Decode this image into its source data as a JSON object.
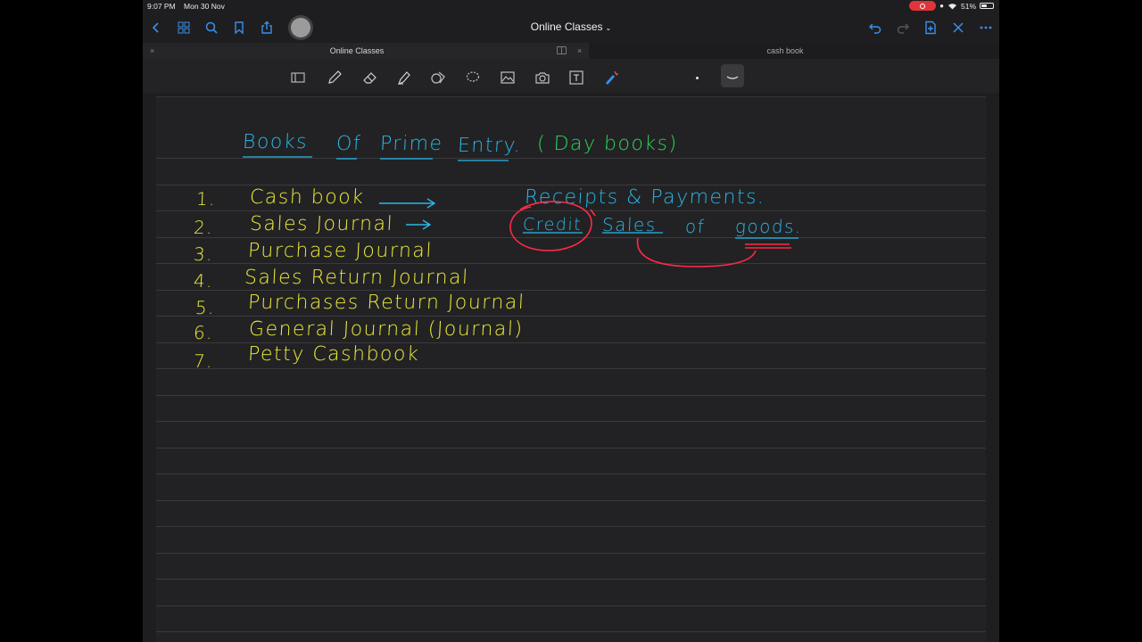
{
  "status": {
    "time": "9:07 PM",
    "date": "Mon 30 Nov",
    "battery": "51%",
    "battery_level": 0.51
  },
  "nav": {
    "title": "Online Classes"
  },
  "tabs": [
    {
      "label": "Online Classes",
      "active": true
    },
    {
      "label": "cash book",
      "active": false
    }
  ],
  "toolbar": {
    "tools": [
      "shapes-icon",
      "pen-icon",
      "eraser-icon",
      "highlighter-icon",
      "lasso-shapes-icon",
      "lasso-icon",
      "image-icon",
      "camera-icon",
      "text-icon",
      "laser-pointer-icon"
    ]
  },
  "note": {
    "heading": {
      "books": "Books",
      "of": "Of",
      "prime": "Prime",
      "entry": "Entry.",
      "day_books": "( Day books)"
    },
    "items": [
      {
        "number": "1.",
        "label": "Cash book"
      },
      {
        "number": "2.",
        "label": "Sales Journal"
      },
      {
        "number": "3.",
        "label": "Purchase Journal"
      },
      {
        "number": "4.",
        "label": "Sales Return Journal"
      },
      {
        "number": "5.",
        "label": "Purchases Return Journal"
      },
      {
        "number": "6.",
        "label": "General Journal (Journal)"
      },
      {
        "number": "7.",
        "label": "Petty Cashbook"
      }
    ],
    "notes": {
      "receipts": "Receipts & Payments.",
      "credit": "Credit",
      "sales": "Sales",
      "of": "of",
      "goods": "goods."
    }
  },
  "colors": {
    "heading": "#28b8e8",
    "list": "#ecec3a",
    "annotation": "#28d957",
    "ink_red": "#ff2a45",
    "background": "#222224",
    "nav_blue": "#3b8fe8"
  }
}
